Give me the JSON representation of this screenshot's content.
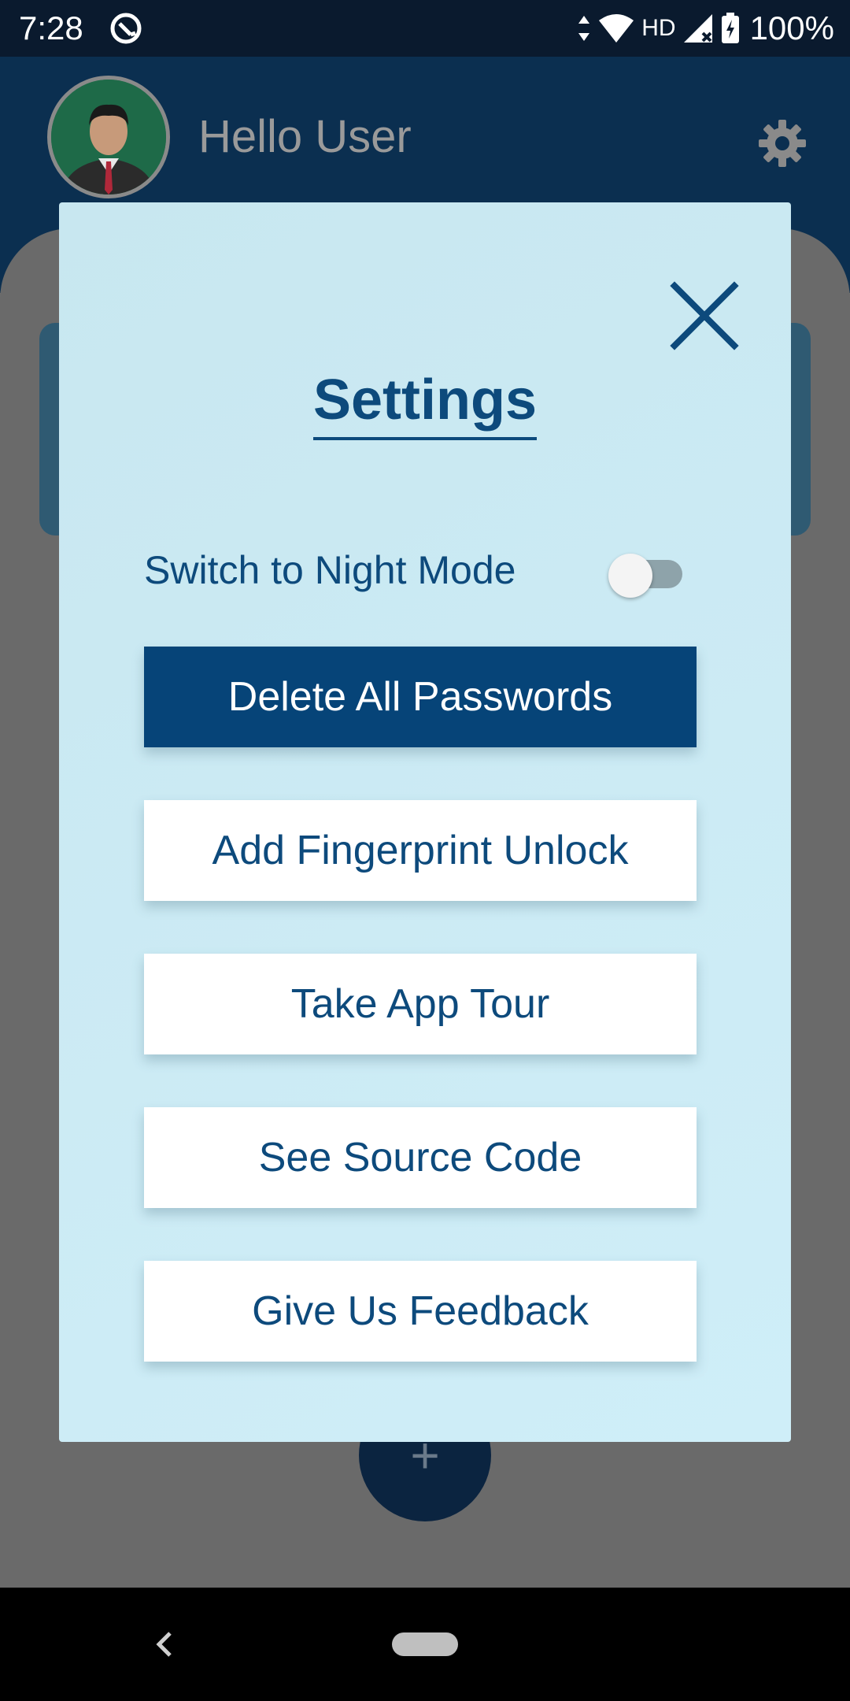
{
  "status_bar": {
    "time": "7:28",
    "network": "HD",
    "battery": "100%"
  },
  "header": {
    "greeting": "Hello User"
  },
  "fab": {
    "label": "+"
  },
  "dialog": {
    "title": "Settings",
    "night_mode": {
      "label": "Switch to Night Mode",
      "enabled": false
    },
    "buttons": [
      {
        "label": "Delete All Passwords"
      },
      {
        "label": "Add Fingerprint Unlock"
      },
      {
        "label": "Take App Tour"
      },
      {
        "label": "See Source Code"
      },
      {
        "label": "Give Us Feedback"
      }
    ]
  },
  "colors": {
    "accent": "#0d4a7c",
    "primary_button": "#064478",
    "dialog_bg": "#c8e7f0"
  },
  "icons": [
    "app-logo-icon",
    "wifi-icon",
    "signal-icon",
    "battery-icon",
    "gear-icon",
    "close-icon",
    "back-icon"
  ]
}
